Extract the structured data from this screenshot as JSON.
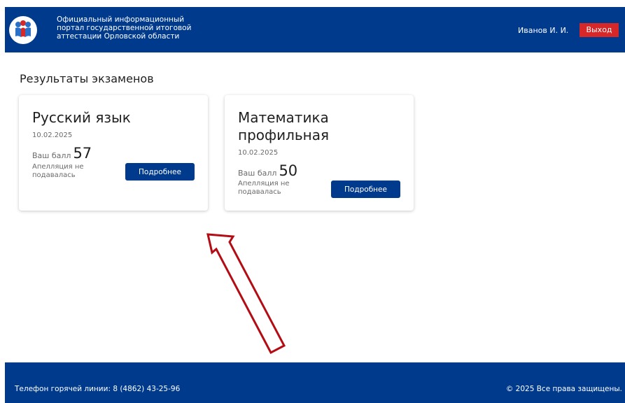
{
  "header": {
    "logo_icon": "gia-logo-icon",
    "title": "Официальный информационный\nпортал государственной итоговой\nаттестации Орловской области",
    "user_name": "Иванов И. И.",
    "logout_label": "Выход"
  },
  "main": {
    "title": "Результаты экзаменов",
    "cards": [
      {
        "subject": "Русский язык",
        "date": "10.02.2025",
        "score_label": "Ваш балл",
        "score": "57",
        "appeal": "Апелляция не подавалась",
        "details_label": "Подробнее"
      },
      {
        "subject": "Математика профильная",
        "date": "10.02.2025",
        "score_label": "Ваш балл",
        "score": "50",
        "appeal": "Апелляция не подавалась",
        "details_label": "Подробнее"
      }
    ]
  },
  "annotation": {
    "arrow_icon": "arrow-up-left-icon",
    "color": "#b40c14"
  },
  "footer": {
    "hotline": "Телефон горячей линии: 8 (4862) 43-25-96",
    "copyright": "© 2025 Все права защищены."
  },
  "colors": {
    "brand_blue": "#003a8c",
    "logout_red": "#d62828"
  }
}
